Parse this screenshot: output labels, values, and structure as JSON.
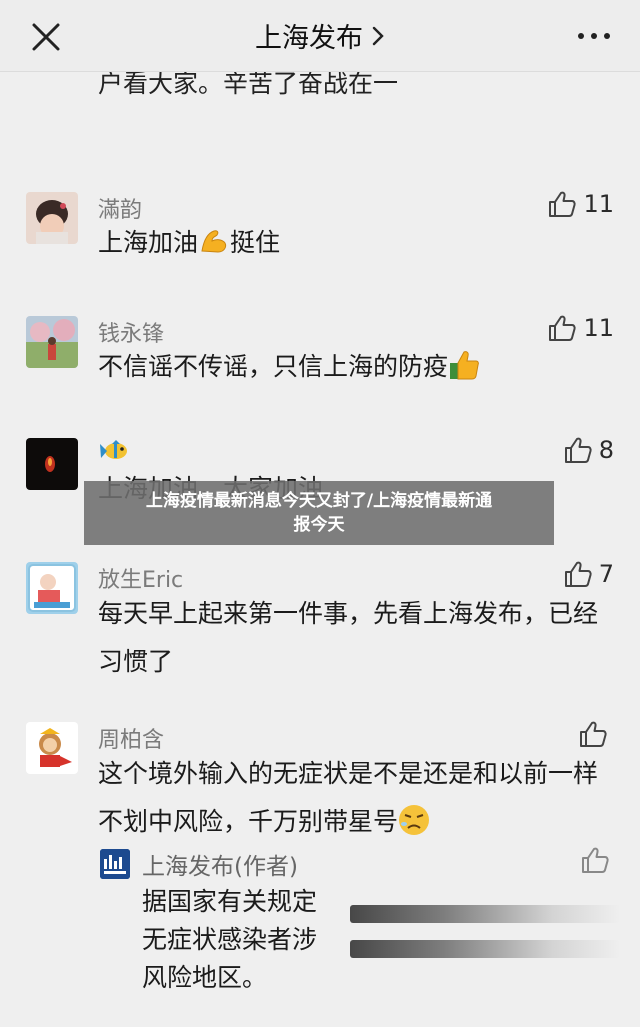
{
  "header": {
    "title": "上海发布"
  },
  "top_snippet": "户看大家。辛苦了奋战在一",
  "comments": [
    {
      "name": "滿韵",
      "text": "上海加油",
      "text_after": "挺住",
      "likes": "11"
    },
    {
      "name": "钱永锋",
      "text": "不信谣不传谣，只信上海的防疫",
      "likes": "11"
    },
    {
      "name": "",
      "text": "上海加油，大家加油",
      "likes": "8"
    },
    {
      "name": "放生Eric",
      "text": "每天早上起来第一件事，先看上海发布，已经习惯了",
      "likes": "7"
    },
    {
      "name": "周柏含",
      "text": "这个境外输入的无症状是不是还是和以前一样不划中风险，千万别带星号",
      "likes": ""
    }
  ],
  "reply": {
    "name": "上海发布(作者)",
    "lines": [
      "据国家有关规定",
      "无症状感染者涉",
      "风险地区。"
    ]
  },
  "banner": {
    "line1": "上海疫情最新消息今天又封了/上海疫情最新通",
    "line2": "报今天"
  },
  "colors": {
    "background": "#efefef",
    "header_bg": "#ededed",
    "name_gray": "#7b7b7b",
    "banner_bg": "#6e6e6e"
  }
}
